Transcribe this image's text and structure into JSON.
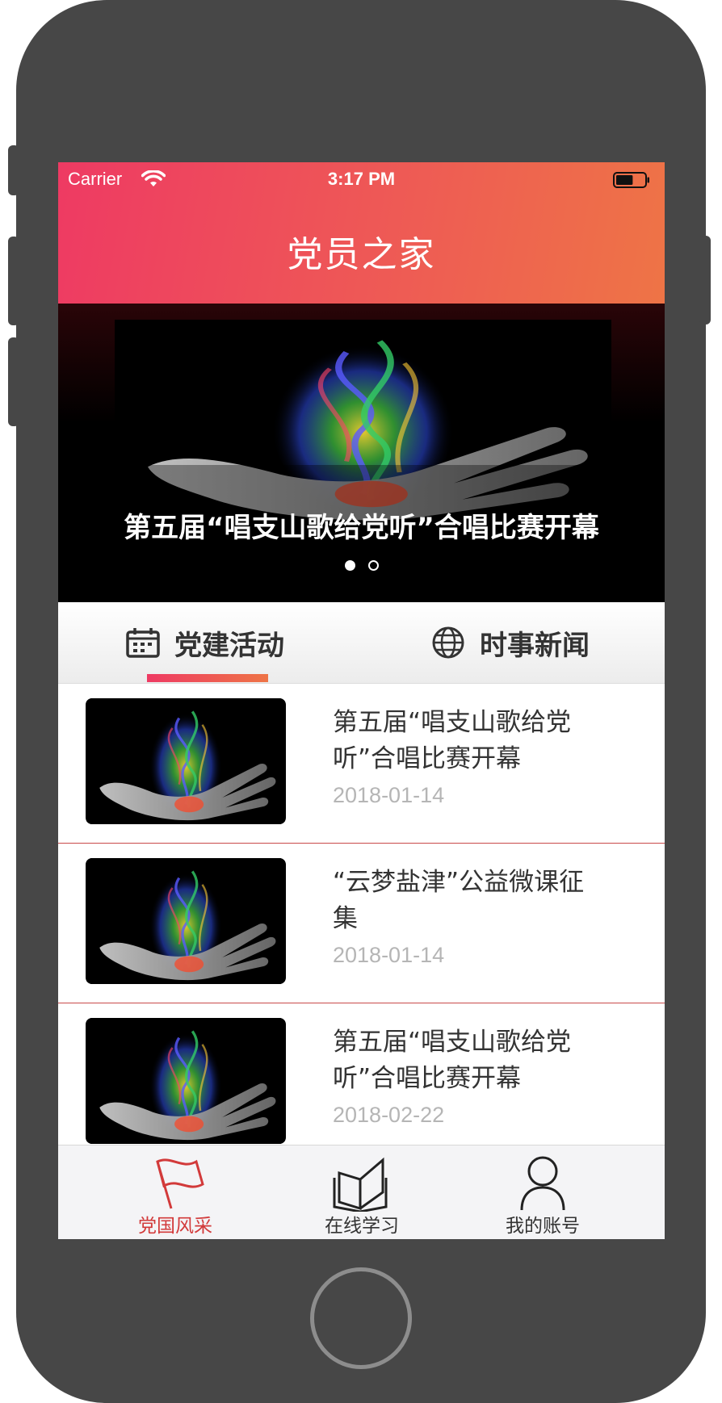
{
  "status_bar": {
    "carrier": "Carrier",
    "time": "3:17 PM",
    "battery_level": 0.6
  },
  "header": {
    "title": "党员之家"
  },
  "banner": {
    "caption": "第五届“唱支山歌给党听”合唱比赛开幕",
    "page_count": 2,
    "active_page": 1
  },
  "tabs": [
    {
      "label": "党建活动",
      "icon": "calendar-icon",
      "active": true
    },
    {
      "label": "时事新闻",
      "icon": "globe-icon",
      "active": false
    }
  ],
  "articles": [
    {
      "title": "第五届“唱支山歌给党听”合唱比赛开幕",
      "date": "2018-01-14"
    },
    {
      "title": "“云梦盐津”公益微课征集",
      "date": "2018-01-14"
    },
    {
      "title": "第五届“唱支山歌给党听”合唱比赛开幕",
      "date": "2018-02-22"
    }
  ],
  "tabbar": [
    {
      "label": "党国风采",
      "icon": "flag-icon",
      "active": true
    },
    {
      "label": "在线学习",
      "icon": "open-book-icon",
      "active": false
    },
    {
      "label": "我的账号",
      "icon": "user-icon",
      "active": false
    }
  ],
  "colors": {
    "header_gradient_start": "#ee3a63",
    "header_gradient_end": "#ee7446",
    "active_tab": "#d23a3a",
    "divider": "#c94a4a"
  }
}
